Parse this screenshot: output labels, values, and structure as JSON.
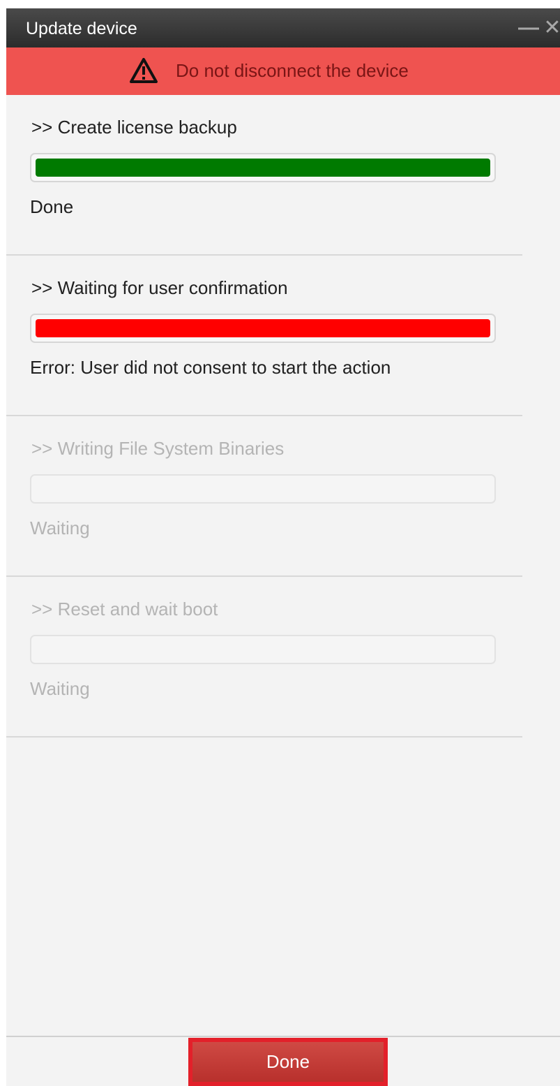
{
  "window": {
    "title": "Update device",
    "minimize_glyph": "—",
    "close_glyph": "✕"
  },
  "warning": {
    "icon": "warning-triangle-icon",
    "text": "Do not disconnect the device",
    "color": "#ef5350"
  },
  "steps": [
    {
      "title": ">> Create license backup",
      "status": "Done",
      "state": "done",
      "progress": 1.0,
      "color": "#007a00"
    },
    {
      "title": ">> Waiting for user confirmation",
      "status": "Error: User did not consent to start the action",
      "state": "error",
      "progress": 1.0,
      "color": "#ff0000"
    },
    {
      "title": ">> Writing File System Binaries",
      "status": "Waiting",
      "state": "pending",
      "progress": 0.0,
      "color": "#b4b4b4"
    },
    {
      "title": ">> Reset and wait boot",
      "status": "Waiting",
      "state": "pending",
      "progress": 0.0,
      "color": "#b4b4b4"
    }
  ],
  "footer": {
    "done_label": "Done",
    "highlight_color": "#e3202a"
  }
}
